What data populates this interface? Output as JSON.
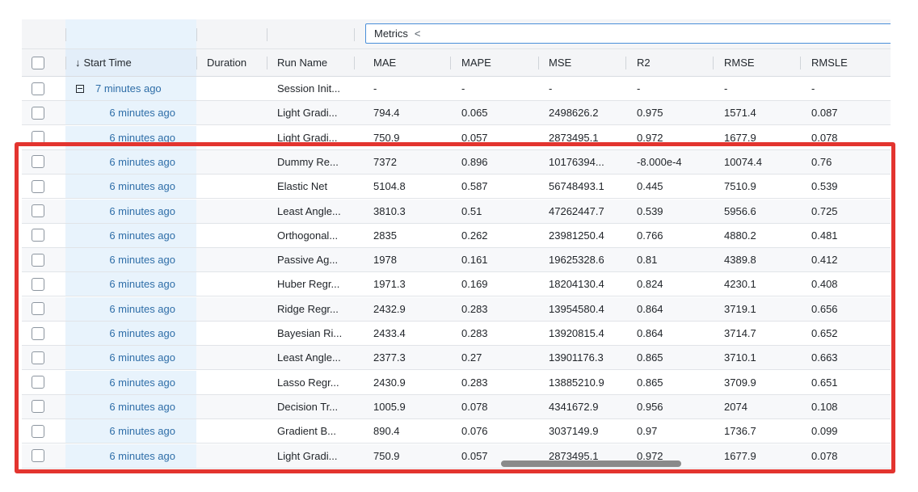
{
  "metrics_group": {
    "label": "Metrics",
    "chevron": "<"
  },
  "columns": {
    "start_time": "Start Time",
    "duration": "Duration",
    "run_name": "Run Name",
    "mae": "MAE",
    "mape": "MAPE",
    "mse": "MSE",
    "r2": "R2",
    "rmse": "RMSE",
    "rmsle": "RMSLE"
  },
  "icons": {
    "sort": "sort-descending-arrow-icon",
    "collapse": "collapse-minus-box-icon",
    "chevron": "chevron-left-icon"
  },
  "rows": [
    {
      "start": "7 minutes ago",
      "duration": "",
      "run_name": "Session Init...",
      "mae": "-",
      "mape": "-",
      "mse": "-",
      "r2": "-",
      "rmse": "-",
      "rmsle": "-"
    },
    {
      "start": "6 minutes ago",
      "duration": "",
      "run_name": "Light Gradi...",
      "mae": "794.4",
      "mape": "0.065",
      "mse": "2498626.2",
      "r2": "0.975",
      "rmse": "1571.4",
      "rmsle": "0.087"
    },
    {
      "start": "6 minutes ago",
      "duration": "",
      "run_name": "Light Gradi...",
      "mae": "750.9",
      "mape": "0.057",
      "mse": "2873495.1",
      "r2": "0.972",
      "rmse": "1677.9",
      "rmsle": "0.078"
    },
    {
      "start": "6 minutes ago",
      "duration": "",
      "run_name": "Dummy Re...",
      "mae": "7372",
      "mape": "0.896",
      "mse": "10176394...",
      "r2": "-8.000e-4",
      "rmse": "10074.4",
      "rmsle": "0.76"
    },
    {
      "start": "6 minutes ago",
      "duration": "",
      "run_name": "Elastic Net",
      "mae": "5104.8",
      "mape": "0.587",
      "mse": "56748493.1",
      "r2": "0.445",
      "rmse": "7510.9",
      "rmsle": "0.539"
    },
    {
      "start": "6 minutes ago",
      "duration": "",
      "run_name": "Least Angle...",
      "mae": "3810.3",
      "mape": "0.51",
      "mse": "47262447.7",
      "r2": "0.539",
      "rmse": "5956.6",
      "rmsle": "0.725"
    },
    {
      "start": "6 minutes ago",
      "duration": "",
      "run_name": "Orthogonal...",
      "mae": "2835",
      "mape": "0.262",
      "mse": "23981250.4",
      "r2": "0.766",
      "rmse": "4880.2",
      "rmsle": "0.481"
    },
    {
      "start": "6 minutes ago",
      "duration": "",
      "run_name": "Passive Ag...",
      "mae": "1978",
      "mape": "0.161",
      "mse": "19625328.6",
      "r2": "0.81",
      "rmse": "4389.8",
      "rmsle": "0.412"
    },
    {
      "start": "6 minutes ago",
      "duration": "",
      "run_name": "Huber Regr...",
      "mae": "1971.3",
      "mape": "0.169",
      "mse": "18204130.4",
      "r2": "0.824",
      "rmse": "4230.1",
      "rmsle": "0.408"
    },
    {
      "start": "6 minutes ago",
      "duration": "",
      "run_name": "Ridge Regr...",
      "mae": "2432.9",
      "mape": "0.283",
      "mse": "13954580.4",
      "r2": "0.864",
      "rmse": "3719.1",
      "rmsle": "0.656"
    },
    {
      "start": "6 minutes ago",
      "duration": "",
      "run_name": "Bayesian Ri...",
      "mae": "2433.4",
      "mape": "0.283",
      "mse": "13920815.4",
      "r2": "0.864",
      "rmse": "3714.7",
      "rmsle": "0.652"
    },
    {
      "start": "6 minutes ago",
      "duration": "",
      "run_name": "Least Angle...",
      "mae": "2377.3",
      "mape": "0.27",
      "mse": "13901176.3",
      "r2": "0.865",
      "rmse": "3710.1",
      "rmsle": "0.663"
    },
    {
      "start": "6 minutes ago",
      "duration": "",
      "run_name": "Lasso Regr...",
      "mae": "2430.9",
      "mape": "0.283",
      "mse": "13885210.9",
      "r2": "0.865",
      "rmse": "3709.9",
      "rmsle": "0.651"
    },
    {
      "start": "6 minutes ago",
      "duration": "",
      "run_name": "Decision Tr...",
      "mae": "1005.9",
      "mape": "0.078",
      "mse": "4341672.9",
      "r2": "0.956",
      "rmse": "2074",
      "rmsle": "0.108"
    },
    {
      "start": "6 minutes ago",
      "duration": "",
      "run_name": "Gradient B...",
      "mae": "890.4",
      "mape": "0.076",
      "mse": "3037149.9",
      "r2": "0.97",
      "rmse": "1736.7",
      "rmsle": "0.099"
    },
    {
      "start": "6 minutes ago",
      "duration": "",
      "run_name": "Light Gradi...",
      "mae": "750.9",
      "mape": "0.057",
      "mse": "2873495.1",
      "r2": "0.972",
      "rmse": "1677.9",
      "rmsle": "0.078"
    }
  ],
  "colors": {
    "highlight": "#e3342f",
    "link": "#2f6ea8",
    "start_column_bg": "#e8f3fc",
    "metrics_border": "#4a8fd9"
  }
}
